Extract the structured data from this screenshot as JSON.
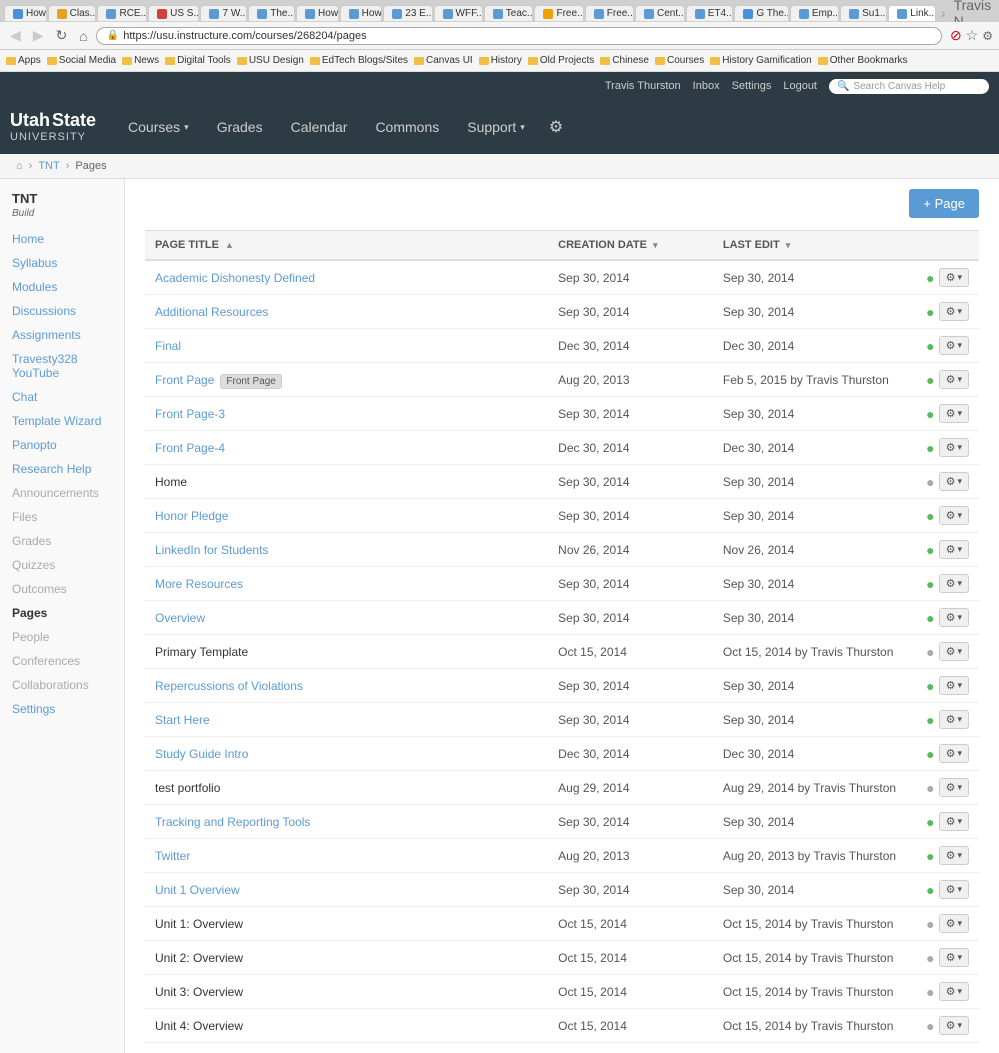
{
  "browser": {
    "tabs": [
      {
        "label": "How",
        "color": "#4a90d9",
        "active": false
      },
      {
        "label": "Clas...",
        "color": "#e8a020",
        "active": false
      },
      {
        "label": "RCE...",
        "color": "#5b9bd5",
        "active": false
      },
      {
        "label": "US S...",
        "color": "#d04040",
        "active": false
      },
      {
        "label": "7 W...",
        "color": "#5b9bd5",
        "active": false
      },
      {
        "label": "The...",
        "color": "#5b9bd5",
        "active": false
      },
      {
        "label": "How...",
        "color": "#5b9bd5",
        "active": false
      },
      {
        "label": "How...",
        "color": "#5b9bd5",
        "active": false
      },
      {
        "label": "23 E...",
        "color": "#5b9bd5",
        "active": false
      },
      {
        "label": "WFF...",
        "color": "#5b9bd5",
        "active": false
      },
      {
        "label": "Teac...",
        "color": "#5b9bd5",
        "active": false
      },
      {
        "label": "Free...",
        "color": "#f0a000",
        "active": false
      },
      {
        "label": "Free...",
        "color": "#5b9bd5",
        "active": false
      },
      {
        "label": "Cent...",
        "color": "#5b9bd5",
        "active": false
      },
      {
        "label": "ET4...",
        "color": "#5b9bd5",
        "active": false
      },
      {
        "label": "G The...",
        "color": "#4a90d9",
        "active": false
      },
      {
        "label": "Emp...",
        "color": "#5b9bd5",
        "active": false
      },
      {
        "label": "Su1...",
        "color": "#5b9bd5",
        "active": false
      },
      {
        "label": "Link...",
        "color": "#5b9bd5",
        "active": true
      }
    ],
    "address": "https://usu.instructure.com/courses/268204/pages",
    "user": "Travis N."
  },
  "bookmarks": [
    {
      "label": "Apps"
    },
    {
      "label": "Social Media"
    },
    {
      "label": "News"
    },
    {
      "label": "Digital Tools"
    },
    {
      "label": "USU Design"
    },
    {
      "label": "EdTech Blogs/Sites"
    },
    {
      "label": "Canvas UI"
    },
    {
      "label": "History"
    },
    {
      "label": "Old Projects"
    },
    {
      "label": "Chinese"
    },
    {
      "label": "Courses"
    },
    {
      "label": "History Gamification"
    },
    {
      "label": "Other Bookmarks"
    }
  ],
  "userbar": {
    "username": "Travis Thurston",
    "links": [
      "Inbox",
      "Settings",
      "Logout"
    ],
    "search_placeholder": "Search Canvas Help"
  },
  "mainnav": {
    "logo_line1": "Utah State",
    "logo_line2": "University",
    "links": [
      {
        "label": "Courses",
        "has_dropdown": true
      },
      {
        "label": "Grades",
        "has_dropdown": false
      },
      {
        "label": "Calendar",
        "has_dropdown": false
      },
      {
        "label": "Commons",
        "has_dropdown": false
      },
      {
        "label": "Support",
        "has_dropdown": true
      }
    ]
  },
  "breadcrumb": {
    "home_icon": "⌂",
    "items": [
      "TNT",
      "Pages"
    ]
  },
  "sidebar": {
    "course_title": "TNT",
    "course_sub": "Build",
    "items": [
      {
        "label": "Home",
        "active": false,
        "disabled": false
      },
      {
        "label": "Syllabus",
        "active": false,
        "disabled": false
      },
      {
        "label": "Modules",
        "active": false,
        "disabled": false
      },
      {
        "label": "Discussions",
        "active": false,
        "disabled": false
      },
      {
        "label": "Assignments",
        "active": false,
        "disabled": false
      },
      {
        "label": "Travesty328 YouTube",
        "active": false,
        "disabled": false
      },
      {
        "label": "Chat",
        "active": false,
        "disabled": false
      },
      {
        "label": "Template Wizard",
        "active": false,
        "disabled": false
      },
      {
        "label": "Panopto",
        "active": false,
        "disabled": false
      },
      {
        "label": "Research Help",
        "active": false,
        "disabled": false
      },
      {
        "label": "Announcements",
        "active": false,
        "disabled": true
      },
      {
        "label": "Files",
        "active": false,
        "disabled": true
      },
      {
        "label": "Grades",
        "active": false,
        "disabled": true
      },
      {
        "label": "Quizzes",
        "active": false,
        "disabled": true
      },
      {
        "label": "Outcomes",
        "active": false,
        "disabled": true
      },
      {
        "label": "Pages",
        "active": true,
        "disabled": false
      },
      {
        "label": "People",
        "active": false,
        "disabled": true
      },
      {
        "label": "Conferences",
        "active": false,
        "disabled": true
      },
      {
        "label": "Collaborations",
        "active": false,
        "disabled": true
      },
      {
        "label": "Settings",
        "active": false,
        "disabled": false
      }
    ]
  },
  "pages": {
    "add_button": "+ Page",
    "columns": [
      {
        "label": "PAGE TITLE",
        "sort": "asc"
      },
      {
        "label": "CREATION DATE",
        "sort": "none"
      },
      {
        "label": "LAST EDIT",
        "sort": "none"
      },
      {
        "label": "",
        "sort": "none"
      }
    ],
    "rows": [
      {
        "title": "Academic Dishonesty Defined",
        "link": true,
        "front_page": false,
        "created": "Sep 30, 2014",
        "edited": "Sep 30, 2014",
        "edited_by": "",
        "published": true
      },
      {
        "title": "Additional Resources",
        "link": true,
        "front_page": false,
        "created": "Sep 30, 2014",
        "edited": "Sep 30, 2014",
        "edited_by": "",
        "published": true
      },
      {
        "title": "Final",
        "link": true,
        "front_page": false,
        "created": "Dec 30, 2014",
        "edited": "Dec 30, 2014",
        "edited_by": "",
        "published": true
      },
      {
        "title": "Front Page",
        "link": true,
        "front_page": true,
        "created": "Aug 20, 2013",
        "edited": "Feb 5, 2015 by Travis Thurston",
        "edited_by": "",
        "published": true
      },
      {
        "title": "Front Page-3",
        "link": true,
        "front_page": false,
        "created": "Sep 30, 2014",
        "edited": "Sep 30, 2014",
        "edited_by": "",
        "published": true
      },
      {
        "title": "Front Page-4",
        "link": true,
        "front_page": false,
        "created": "Dec 30, 2014",
        "edited": "Dec 30, 2014",
        "edited_by": "",
        "published": true
      },
      {
        "title": "Home",
        "link": false,
        "front_page": false,
        "created": "Sep 30, 2014",
        "edited": "Sep 30, 2014",
        "edited_by": "",
        "published": false
      },
      {
        "title": "Honor Pledge",
        "link": true,
        "front_page": false,
        "created": "Sep 30, 2014",
        "edited": "Sep 30, 2014",
        "edited_by": "",
        "published": true
      },
      {
        "title": "LinkedIn for Students",
        "link": true,
        "front_page": false,
        "created": "Nov 26, 2014",
        "edited": "Nov 26, 2014",
        "edited_by": "",
        "published": true
      },
      {
        "title": "More Resources",
        "link": true,
        "front_page": false,
        "created": "Sep 30, 2014",
        "edited": "Sep 30, 2014",
        "edited_by": "",
        "published": true
      },
      {
        "title": "Overview",
        "link": true,
        "front_page": false,
        "created": "Sep 30, 2014",
        "edited": "Sep 30, 2014",
        "edited_by": "",
        "published": true
      },
      {
        "title": "Primary Template",
        "link": false,
        "front_page": false,
        "created": "Oct 15, 2014",
        "edited": "Oct 15, 2014 by Travis Thurston",
        "edited_by": "",
        "published": false
      },
      {
        "title": "Repercussions of Violations",
        "link": true,
        "front_page": false,
        "created": "Sep 30, 2014",
        "edited": "Sep 30, 2014",
        "edited_by": "",
        "published": true
      },
      {
        "title": "Start Here",
        "link": true,
        "front_page": false,
        "created": "Sep 30, 2014",
        "edited": "Sep 30, 2014",
        "edited_by": "",
        "published": true
      },
      {
        "title": "Study Guide Intro",
        "link": true,
        "front_page": false,
        "created": "Dec 30, 2014",
        "edited": "Dec 30, 2014",
        "edited_by": "",
        "published": true
      },
      {
        "title": "test portfolio",
        "link": false,
        "front_page": false,
        "created": "Aug 29, 2014",
        "edited": "Aug 29, 2014 by Travis Thurston",
        "edited_by": "",
        "published": false
      },
      {
        "title": "Tracking and Reporting Tools",
        "link": true,
        "front_page": false,
        "created": "Sep 30, 2014",
        "edited": "Sep 30, 2014",
        "edited_by": "",
        "published": true
      },
      {
        "title": "Twitter",
        "link": true,
        "front_page": false,
        "created": "Aug 20, 2013",
        "edited": "Aug 20, 2013 by Travis Thurston",
        "edited_by": "",
        "published": true
      },
      {
        "title": "Unit 1 Overview",
        "link": true,
        "front_page": false,
        "created": "Sep 30, 2014",
        "edited": "Sep 30, 2014",
        "edited_by": "",
        "published": true
      },
      {
        "title": "Unit 1: Overview",
        "link": false,
        "front_page": false,
        "created": "Oct 15, 2014",
        "edited": "Oct 15, 2014 by Travis Thurston",
        "edited_by": "",
        "published": false
      },
      {
        "title": "Unit 2: Overview",
        "link": false,
        "front_page": false,
        "created": "Oct 15, 2014",
        "edited": "Oct 15, 2014 by Travis Thurston",
        "edited_by": "",
        "published": false
      },
      {
        "title": "Unit 3: Overview",
        "link": false,
        "front_page": false,
        "created": "Oct 15, 2014",
        "edited": "Oct 15, 2014 by Travis Thurston",
        "edited_by": "",
        "published": false
      },
      {
        "title": "Unit 4: Overview",
        "link": false,
        "front_page": false,
        "created": "Oct 15, 2014",
        "edited": "Oct 15, 2014 by Travis Thurston",
        "edited_by": "",
        "published": false
      }
    ]
  }
}
